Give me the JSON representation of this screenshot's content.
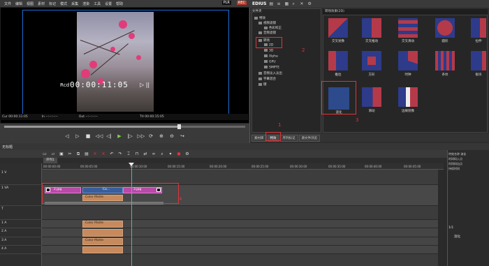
{
  "menubar": {
    "items": [
      "文件",
      "编辑",
      "视图",
      "素材",
      "标记",
      "模式",
      "采集",
      "渲染",
      "工具",
      "设置",
      "帮助"
    ],
    "badges": [
      "PLR",
      "REC"
    ]
  },
  "player": {
    "timecode_label": "Rcd",
    "timecode": "00:00:11:05",
    "timecode_mark": "▷ ||",
    "status": [
      "Cur 00:00:11:05",
      "In --:--:--:--",
      "Out --:--:--:--",
      "Ttl 00:00:15:05"
    ],
    "scrub_progress": 0.725
  },
  "transport": {
    "buttons": [
      "◁",
      "▷",
      "■",
      "◁◁",
      "◁|",
      "▶",
      "|▷",
      "▷▷",
      "⟳",
      "⊕",
      "⊖",
      "↪"
    ]
  },
  "right_panel": {
    "title": "EDIUS",
    "tree_header": "文件夹",
    "tree": [
      {
        "label": "特效",
        "level": 0
      },
      {
        "label": "视频滤镜",
        "level": 1
      },
      {
        "label": "色彩校正",
        "level": 2
      },
      {
        "label": "音频滤镜",
        "level": 1
      },
      {
        "label": "转场",
        "level": 1
      },
      {
        "label": "2D",
        "level": 2
      },
      {
        "label": "3D",
        "level": 2
      },
      {
        "label": "Alpha",
        "level": 2
      },
      {
        "label": "GPU",
        "level": 2
      },
      {
        "label": "SMPTE",
        "level": 2
      },
      {
        "label": "音频淡入淡出",
        "level": 1
      },
      {
        "label": "字幕混合",
        "level": 1
      },
      {
        "label": "键",
        "level": 1
      }
    ],
    "thumbs_header": "转场效果(2D)",
    "thumbs": [
      {
        "label": "交叉划像",
        "icon": "transition-icon"
      },
      {
        "label": "交叉推动",
        "icon": "transition-icon"
      },
      {
        "label": "交叉滑动",
        "icon": "transition-icon"
      },
      {
        "label": "圆形",
        "icon": "transition-icon"
      },
      {
        "label": "拉伸",
        "icon": "transition-icon"
      },
      {
        "label": "推拉",
        "icon": "transition-icon"
      },
      {
        "label": "方形",
        "icon": "transition-icon"
      },
      {
        "label": "时钟",
        "icon": "transition-icon"
      },
      {
        "label": "条纹",
        "icon": "transition-icon"
      },
      {
        "label": "板块",
        "icon": "transition-icon"
      },
      {
        "label": "溶化",
        "icon": "transition-icon"
      },
      {
        "label": "滑动",
        "icon": "transition-icon"
      },
      {
        "label": "边缘划像",
        "icon": "transition-icon"
      }
    ],
    "annotations": [
      "1",
      "2",
      "3",
      "4"
    ],
    "tabs": [
      "素材库",
      "特效",
      "序列标记",
      "源文件浏览"
    ]
  },
  "timeline": {
    "title": "无标题",
    "sequence_tab": "序列1",
    "ruler": [
      "00:00:00:00",
      "00:00:05:00",
      "00:00:10:00",
      "00:00:15:00",
      "00:00:20:00",
      "00:00:25:00",
      "00:00:30:00",
      "00:00:35:00",
      "00:00:40:00",
      "00:00:45:00",
      "00:00:50:00"
    ],
    "track_headers": [
      "1 V",
      "1 VA",
      "T",
      "1 A",
      "2 A",
      "3 A",
      "4 A"
    ],
    "clips": {
      "v1a": [
        "2.jpg",
        "Co...",
        "3.jpg"
      ],
      "matte": "Color Matte"
    }
  },
  "info_panel": {
    "rows": [
      [
        "特效名称",
        "溶化"
      ],
      [
        "时间码入点",
        ""
      ],
      [
        "时间码出点",
        ""
      ],
      [
        "持续时间",
        ""
      ]
    ],
    "counter": "1/1",
    "item": "溶化"
  },
  "colors": {
    "accent_red": "#e0343a",
    "playhead": "#35c4b8",
    "clip_pink": "#b84aa8",
    "clip_matte": "#c78a5c"
  }
}
